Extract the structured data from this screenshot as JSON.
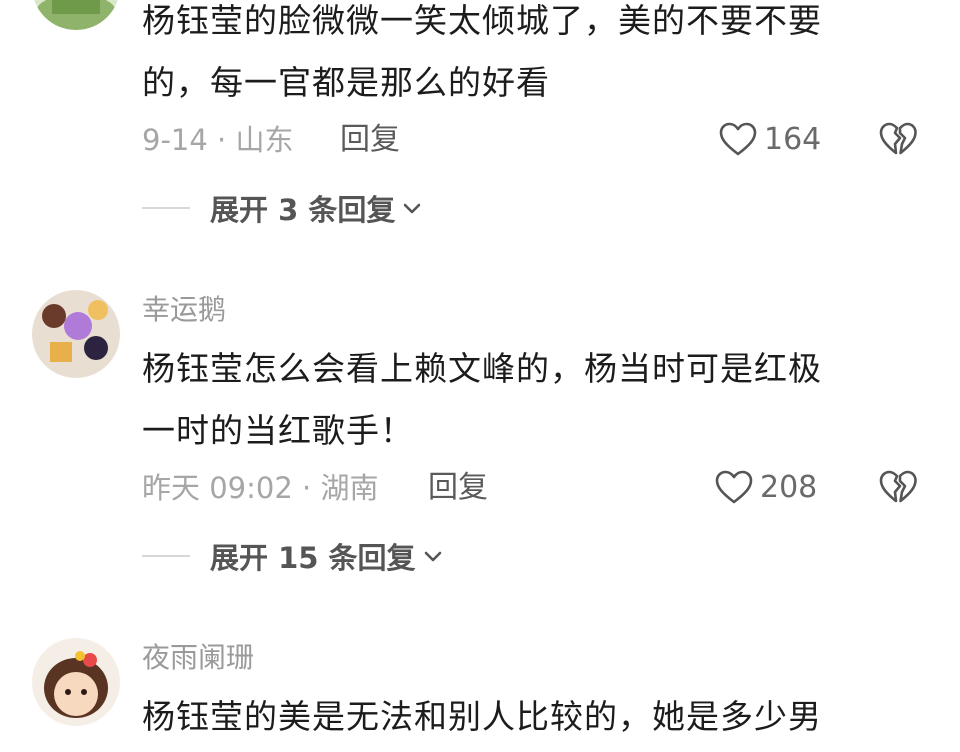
{
  "comments": [
    {
      "text_line1": "杨钰莹的脸微微一笑太倾城了，美的不要不要",
      "text_line2": "的，每一官都是那么的好看",
      "date": "9-14",
      "location": "山东",
      "reply_label": "回复",
      "likes": "164",
      "expand_label": "展开 3 条回复"
    },
    {
      "username": "幸运鹅",
      "text_line1": "杨钰莹怎么会看上赖文峰的，杨当时可是红极",
      "text_line2": "一时的当红歌手！",
      "date": "昨天 09:02",
      "location": "湖南",
      "reply_label": "回复",
      "likes": "208",
      "expand_label": "展开 15 条回复"
    },
    {
      "username": "夜雨阑珊",
      "text_line1": "杨钰莹的美是无法和别人比较的，她是多少男"
    }
  ],
  "icons": {
    "like": "heart-outline-icon",
    "dislike": "broken-heart-icon",
    "expand": "chevron-down-icon"
  },
  "colors": {
    "text": "#1c1c1c",
    "secondary": "#a6a6a6",
    "username": "#9a9a9a",
    "icon": "#555555"
  }
}
